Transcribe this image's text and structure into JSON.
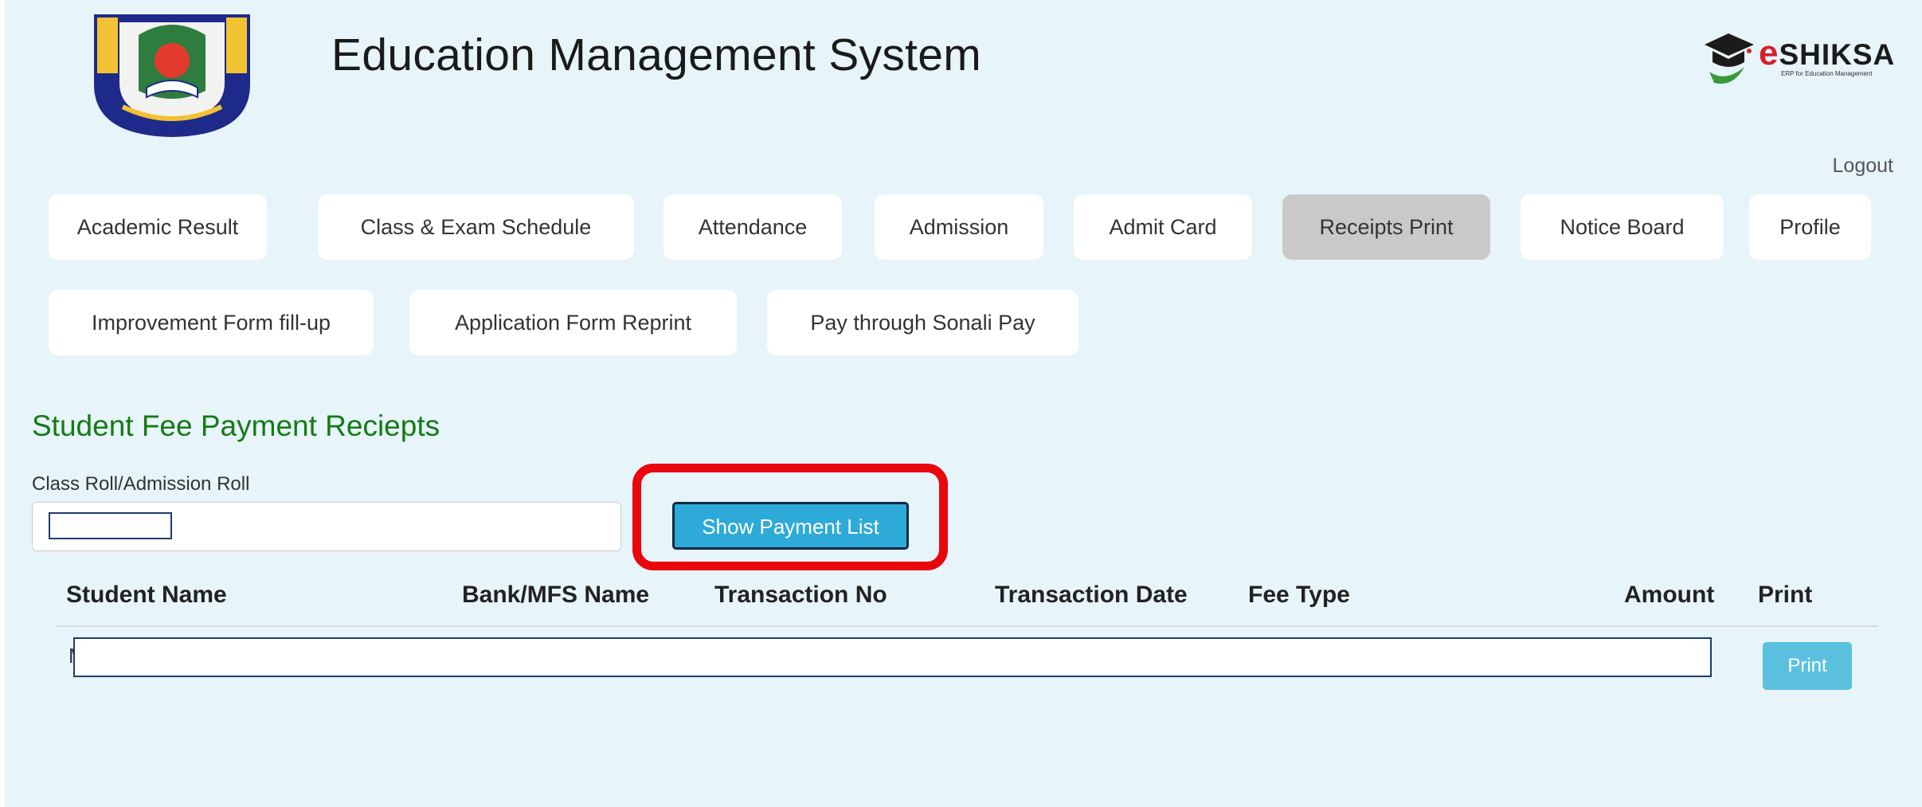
{
  "header": {
    "title": "Education Management System",
    "brand": {
      "name_prefix": "e",
      "name_rest": "SHIKSA",
      "tagline": "ERP for Education Management"
    },
    "logout_label": "Logout"
  },
  "nav": {
    "row1": [
      {
        "label": "Academic Result"
      },
      {
        "label": "Class & Exam Schedule"
      },
      {
        "label": "Attendance"
      },
      {
        "label": "Admission"
      },
      {
        "label": "Admit Card"
      },
      {
        "label": "Receipts Print",
        "active": true
      },
      {
        "label": "Notice Board"
      },
      {
        "label": "Profile"
      }
    ],
    "row2": [
      {
        "label": "Improvement Form fill-up"
      },
      {
        "label": "Application Form Reprint"
      },
      {
        "label": "Pay through Sonali Pay"
      }
    ]
  },
  "section": {
    "title": "Student Fee Payment Reciepts",
    "roll_label": "Class Roll/Admission Roll",
    "roll_value": "",
    "show_button": "Show Payment List"
  },
  "table": {
    "columns": [
      "Student Name",
      "Bank/MFS Name",
      "Transaction No",
      "Transaction Date",
      "Fee Type",
      "Amount",
      "Print"
    ],
    "rows": [
      {
        "student_name_visible": "M",
        "print_label": "Print"
      }
    ]
  },
  "colors": {
    "panel_bg": "#e7f4fa",
    "section_title": "#157a15",
    "active_tab": "#c9c9c9",
    "primary_button": "#2eaad8",
    "print_button": "#5bc0de",
    "highlight": "#e8070c"
  }
}
